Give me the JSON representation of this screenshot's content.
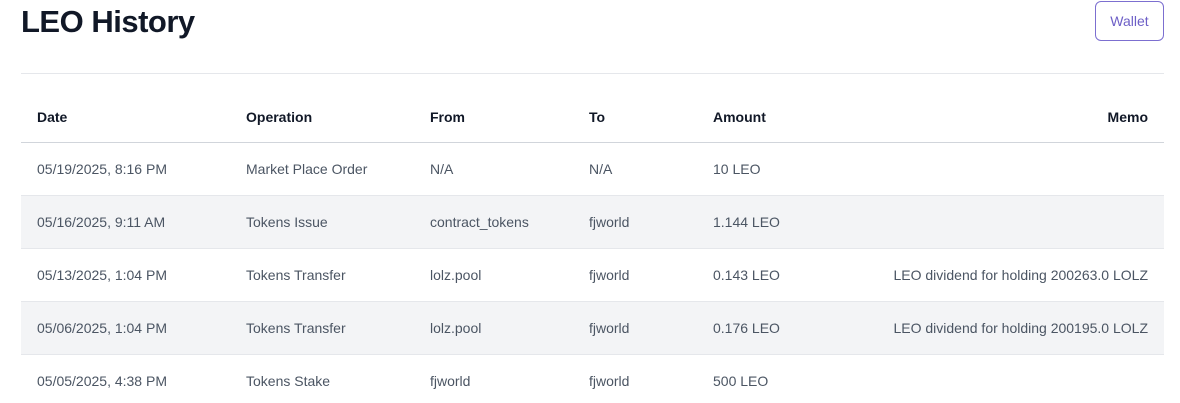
{
  "header": {
    "title": "LEO History",
    "wallet_label": "Wallet"
  },
  "table": {
    "columns": [
      "Date",
      "Operation",
      "From",
      "To",
      "Amount",
      "Memo"
    ],
    "rows": [
      {
        "date": "05/19/2025, 8:16 PM",
        "operation": "Market Place Order",
        "from": "N/A",
        "to": "N/A",
        "amount": "10 LEO",
        "memo": ""
      },
      {
        "date": "05/16/2025, 9:11 AM",
        "operation": "Tokens Issue",
        "from": "contract_tokens",
        "to": "fjworld",
        "amount": "1.144 LEO",
        "memo": ""
      },
      {
        "date": "05/13/2025, 1:04 PM",
        "operation": "Tokens Transfer",
        "from": "lolz.pool",
        "to": "fjworld",
        "amount": "0.143 LEO",
        "memo": "LEO dividend for holding 200263.0 LOLZ"
      },
      {
        "date": "05/06/2025, 1:04 PM",
        "operation": "Tokens Transfer",
        "from": "lolz.pool",
        "to": "fjworld",
        "amount": "0.176 LEO",
        "memo": "LEO dividend for holding 200195.0 LOLZ"
      },
      {
        "date": "05/05/2025, 4:38 PM",
        "operation": "Tokens Stake",
        "from": "fjworld",
        "to": "fjworld",
        "amount": "500 LEO",
        "memo": ""
      }
    ]
  },
  "colors": {
    "accent": "#6d5fc7",
    "row_alt_bg": "#f3f4f6",
    "text_muted": "#4b5563"
  }
}
